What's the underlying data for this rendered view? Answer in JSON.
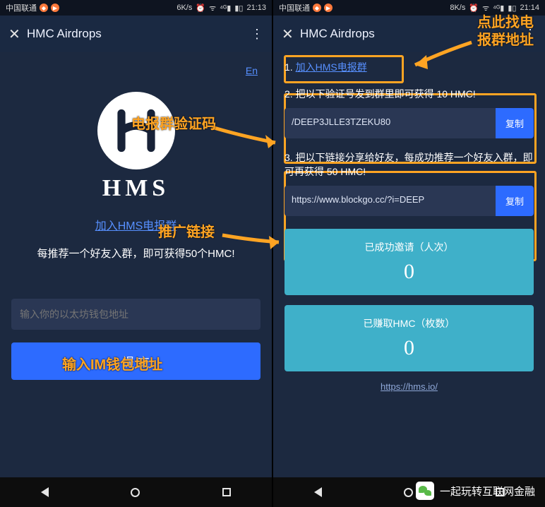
{
  "left": {
    "status": {
      "carrier": "中国联通",
      "speed": "6K/s",
      "time": "21:13"
    },
    "appbar": {
      "title": "HMC Airdrops"
    },
    "en_link": "En",
    "logo_text": "HMS",
    "join_link": "加入HMS电报群",
    "promo": "每推荐一个好友入群，即可获得50个HMC!",
    "wallet_placeholder": "输入你的以太坊钱包地址",
    "submit": "提 交"
  },
  "right": {
    "status": {
      "carrier": "中国联通",
      "speed": "8K/s",
      "time": "21:14"
    },
    "appbar": {
      "title": "HMC Airdrops"
    },
    "step1": {
      "num": "1.",
      "link": "加入HMS电报群"
    },
    "step2": {
      "title": "2. 把以下验证号发到群里即可获得 10 HMC!",
      "code": "/DEEP3JLLE3TZEKU80",
      "copy": "复制"
    },
    "step3": {
      "title": "3. 把以下链接分享给好友，每成功推荐一个好友入群，即可再获得 50 HMC!",
      "url": "https://www.blockgo.cc/?i=DEEP",
      "copy": "复制"
    },
    "stat1": {
      "label": "已成功邀请（人次）",
      "value": "0"
    },
    "stat2": {
      "label": "已赚取HMC（枚数）",
      "value": "0"
    },
    "footer": "https://hms.io/"
  },
  "anno": {
    "code_label": "电报群验证码",
    "link_label": "推广链接",
    "wallet_label": "输入IM钱包地址",
    "find_label": "点此找电报群地址"
  },
  "wechat": "一起玩转互联网金融"
}
